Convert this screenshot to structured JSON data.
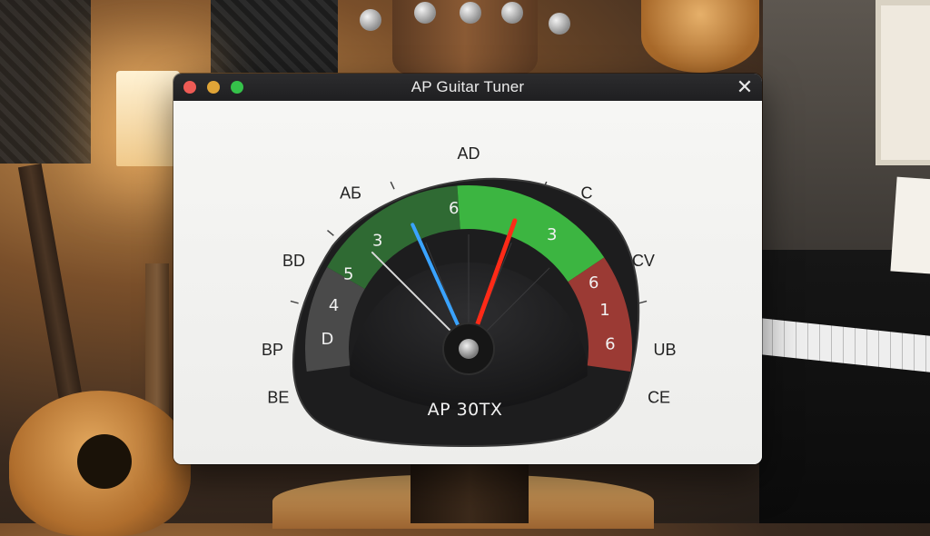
{
  "window": {
    "title": "AP Guitar Tuner",
    "close_glyph": "✕"
  },
  "tuner": {
    "model": "AP 30TX",
    "note_labels": [
      "BE",
      "BP",
      "BD",
      "AБ",
      "AD",
      "C",
      "CV",
      "UB",
      "CE"
    ],
    "scale_numbers": [
      "D",
      "4",
      "5",
      "3",
      "6",
      "3",
      "6",
      "1",
      "6"
    ],
    "zones": {
      "left": "gray",
      "center_left": "dark-green",
      "center_right": "bright-green",
      "right": "red"
    },
    "needles": [
      {
        "name": "reference",
        "color": "#3aa3ff",
        "value": -0.27
      },
      {
        "name": "pitch",
        "color": "#ff2a17",
        "value": 0.22
      },
      {
        "name": "secondary",
        "color": "#d9d9d9",
        "value": -0.5
      }
    ]
  },
  "colors": {
    "bezel": "#1e1e1f",
    "gray_zone": "#4a4a4a",
    "green_dark": "#2f6a33",
    "green_bright": "#3cb541",
    "red_zone": "#9b3a34",
    "window_bg": "#f3f3f1",
    "titlebar": "#262628"
  },
  "icons": [
    "close-icon",
    "traffic-close-icon",
    "traffic-minimize-icon",
    "traffic-maximize-icon"
  ]
}
